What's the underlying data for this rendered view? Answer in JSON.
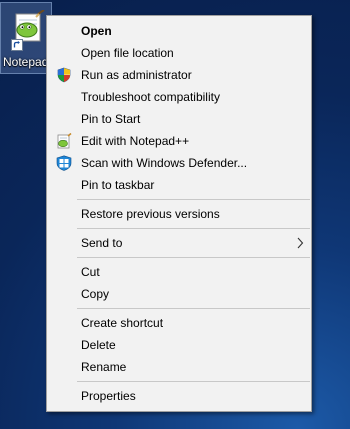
{
  "desktop": {
    "shortcut_label": "Notepad++",
    "shortcut_icon": "notepad-plus-plus-icon"
  },
  "context_menu": {
    "items": [
      {
        "label": "Open",
        "bold": true
      },
      {
        "label": "Open file location"
      },
      {
        "label": "Run as administrator",
        "icon": "uac-shield-icon"
      },
      {
        "label": "Troubleshoot compatibility"
      },
      {
        "label": "Pin to Start"
      },
      {
        "label": "Edit with Notepad++",
        "icon": "notepad-plus-plus-icon"
      },
      {
        "label": "Scan with Windows Defender...",
        "icon": "windows-defender-icon"
      },
      {
        "label": "Pin to taskbar"
      },
      {
        "label": "Restore previous versions"
      },
      {
        "label": "Send to",
        "submenu": true
      },
      {
        "label": "Cut"
      },
      {
        "label": "Copy"
      },
      {
        "label": "Create shortcut"
      },
      {
        "label": "Delete"
      },
      {
        "label": "Rename"
      },
      {
        "label": "Properties"
      }
    ]
  },
  "colors": {
    "menu_background": "#f2f2f2",
    "menu_border": "#a0a0a0",
    "separator": "#c8c8c8",
    "desktop_background": "#0b2a5b"
  }
}
